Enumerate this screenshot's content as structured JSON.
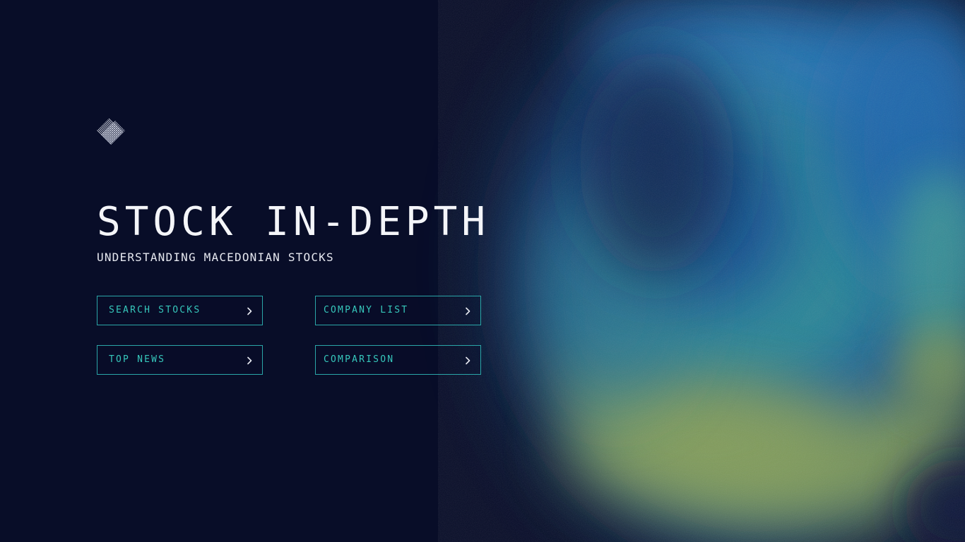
{
  "hero": {
    "logo_icon": "diamond-logo-icon",
    "title": "STOCK IN-DEPTH",
    "subtitle": "UNDERSTANDING MACEDONIAN STOCKS"
  },
  "nav": {
    "buttons": [
      {
        "label": "SEARCH STOCKS",
        "icon": "chevron-right-icon"
      },
      {
        "label": "COMPANY LIST",
        "icon": "chevron-right-icon"
      },
      {
        "label": "TOP NEWS",
        "icon": "chevron-right-icon"
      },
      {
        "label": "COMPARISON",
        "icon": "chevron-right-icon"
      }
    ]
  },
  "colors": {
    "background": "#080d28",
    "accent": "#36c7bb",
    "border": "#2aa6a8",
    "text": "#f4f5f9",
    "gradient_blue": "#1e6fb0",
    "gradient_teal": "#2f8f97",
    "gradient_olive": "#7f9a5a"
  }
}
